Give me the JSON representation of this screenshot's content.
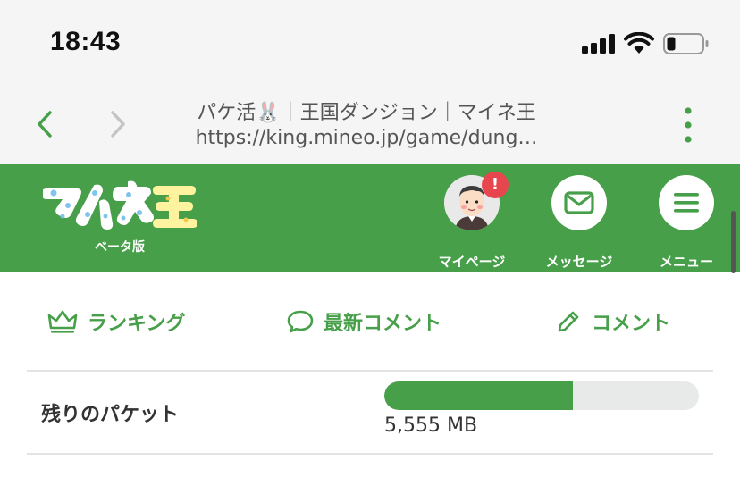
{
  "status_bar": {
    "time": "18:43"
  },
  "browser": {
    "title": "パケ活🐰｜王国ダンジョン｜マイネ王",
    "url": "https://king.mineo.jp/game/dung…"
  },
  "header": {
    "logo_text": "マイネ王",
    "logo_sub": "ベータ版",
    "mypage_label": "マイページ",
    "mypage_badge": "!",
    "message_label": "メッセージ",
    "menu_label": "メニュー"
  },
  "tabs": {
    "ranking": "ランキング",
    "latest_comments": "最新コメント",
    "comment": "コメント"
  },
  "packet": {
    "label": "残りのパケット",
    "value": "5,555 MB",
    "fill_fraction": 0.6
  },
  "colors": {
    "brand_green": "#47a049",
    "alert_red": "#e8464e"
  }
}
